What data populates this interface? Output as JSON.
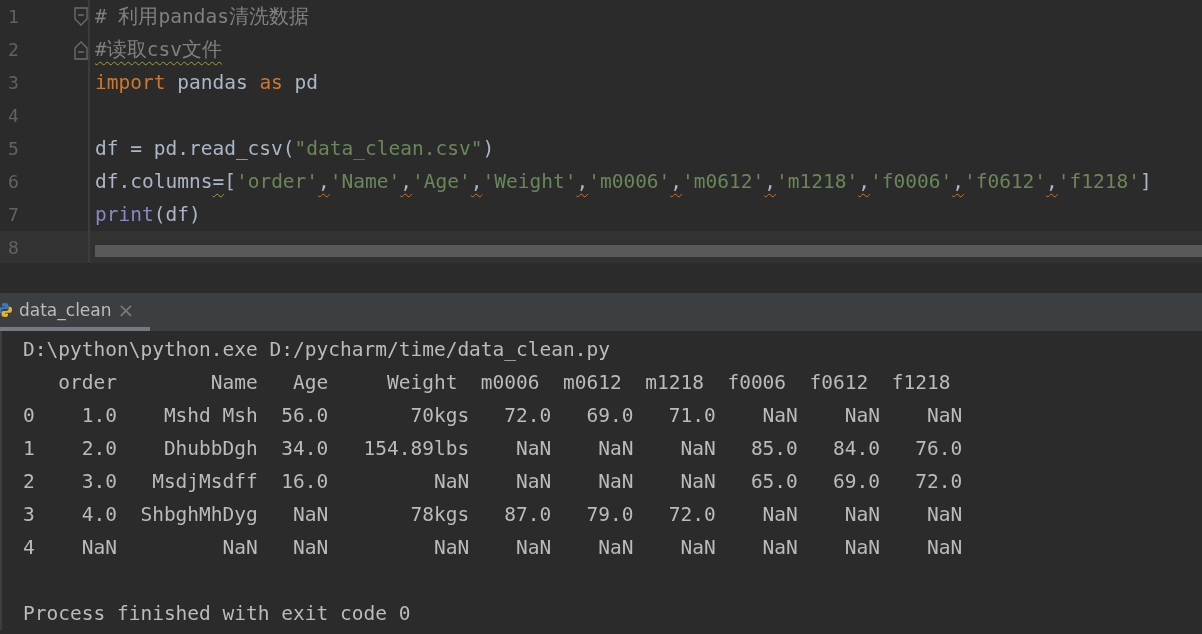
{
  "editor": {
    "lines": [
      {
        "number": "1",
        "fold_start": true,
        "fold_end": false,
        "current": false,
        "tokens": [
          {
            "kind": "comment",
            "text": "# 利用pandas清洗数据"
          }
        ]
      },
      {
        "number": "2",
        "fold_start": false,
        "fold_end": true,
        "current": false,
        "tokens": [
          {
            "kind": "comment-warn",
            "text": "#读取csv文件"
          }
        ]
      },
      {
        "number": "3",
        "current": false,
        "tokens": [
          {
            "kind": "keyword",
            "text": "import"
          },
          {
            "kind": "plain",
            "text": " pandas "
          },
          {
            "kind": "keyword",
            "text": "as"
          },
          {
            "kind": "plain",
            "text": " pd"
          }
        ]
      },
      {
        "number": "4",
        "current": false
      },
      {
        "number": "5",
        "current": false,
        "tokens": [
          {
            "kind": "plain",
            "text": "df = pd.read_csv("
          },
          {
            "kind": "string",
            "text": "\"data_clean.csv\""
          },
          {
            "kind": "plain",
            "text": ")"
          }
        ]
      },
      {
        "number": "6",
        "current": false,
        "tokens": [
          {
            "kind": "plain",
            "text": "df.columns"
          },
          {
            "kind": "plain-warn",
            "text": "="
          },
          {
            "kind": "plain",
            "text": "["
          },
          {
            "kind": "string",
            "text": "'order'"
          },
          {
            "kind": "comma-warn",
            "text": ","
          },
          {
            "kind": "string",
            "text": "'Name'"
          },
          {
            "kind": "comma-warn",
            "text": ","
          },
          {
            "kind": "string",
            "text": "'Age'"
          },
          {
            "kind": "comma-warn",
            "text": ","
          },
          {
            "kind": "string",
            "text": "'Weight'"
          },
          {
            "kind": "comma-warn",
            "text": ","
          },
          {
            "kind": "string",
            "text": "'m0006'"
          },
          {
            "kind": "comma-warn",
            "text": ","
          },
          {
            "kind": "string",
            "text": "'m0612'"
          },
          {
            "kind": "comma-warn",
            "text": ","
          },
          {
            "kind": "string",
            "text": "'m1218'"
          },
          {
            "kind": "comma-warn",
            "text": ","
          },
          {
            "kind": "string",
            "text": "'f0006'"
          },
          {
            "kind": "comma-warn",
            "text": ","
          },
          {
            "kind": "string",
            "text": "'f0612'"
          },
          {
            "kind": "comma-warn",
            "text": ","
          },
          {
            "kind": "string",
            "text": "'f1218'"
          },
          {
            "kind": "plain",
            "text": "]"
          }
        ]
      },
      {
        "number": "7",
        "current": false,
        "tokens": [
          {
            "kind": "builtin",
            "text": "print"
          },
          {
            "kind": "plain",
            "text": "(df)"
          }
        ]
      },
      {
        "number": "8",
        "current": true
      }
    ]
  },
  "run_tab": {
    "title": "data_clean",
    "selected": true,
    "close": "×"
  },
  "console": {
    "lines": [
      {
        "text": "D:\\python\\python.exe D:/pycharm/time/data_clean.py"
      },
      {
        "text": "   order        Name   Age     Weight  m0006  m0612  m1218  f0006  f0612  f1218"
      },
      {
        "text": "0    1.0    Mshd Msh  56.0       70kgs   72.0   69.0   71.0    NaN    NaN    NaN"
      },
      {
        "text": "1    2.0    DhubbDgh  34.0   154.89lbs    NaN    NaN    NaN   85.0   84.0   76.0"
      },
      {
        "text": "2    3.0   MsdjMsdff  16.0         NaN    NaN    NaN    NaN   65.0   69.0   72.0"
      },
      {
        "text": "3    4.0  ShbghMhDyg   NaN       78kgs   87.0   79.0   72.0    NaN    NaN    NaN"
      },
      {
        "text": "4    NaN         NaN   NaN         NaN    NaN    NaN    NaN    NaN    NaN    NaN"
      },
      {
        "text": "Process finished with exit code 0",
        "kind": "exit"
      }
    ]
  }
}
